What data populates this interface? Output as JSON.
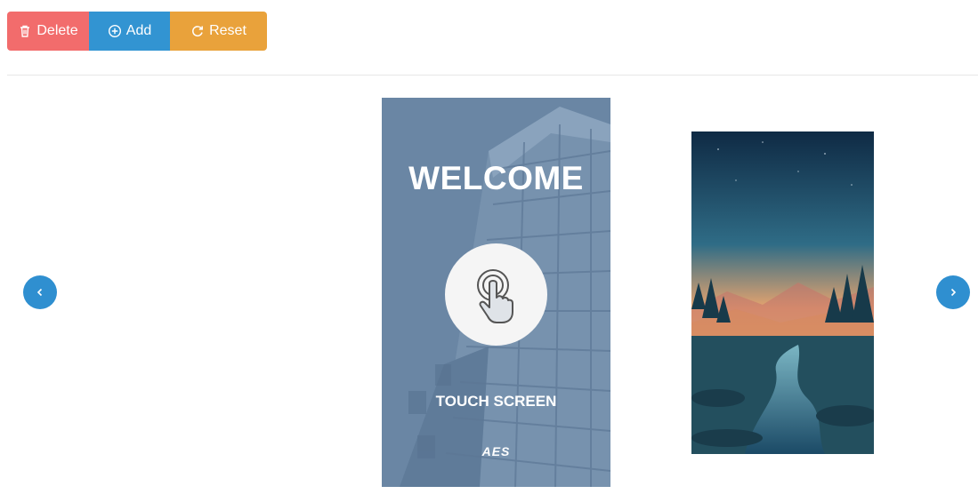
{
  "toolbar": {
    "delete_label": "Delete",
    "add_label": "Add",
    "reset_label": "Reset",
    "delete_icon": "trash-icon",
    "add_icon": "plus-circle-icon",
    "reset_icon": "refresh-icon",
    "colors": {
      "delete": "#f26c6c",
      "add": "#3294d2",
      "reset": "#e9a23b"
    }
  },
  "carousel": {
    "prev_icon": "chevron-left-icon",
    "next_icon": "chevron-right-icon",
    "nav_color": "#2f8fd0",
    "slides": [
      {
        "name": "welcome-slide",
        "title": "WELCOME",
        "icon": "touch-hand-icon",
        "caption": "TOUCH SCREEN",
        "brand": "AES"
      },
      {
        "name": "landscape-slide",
        "description_icon": "landscape-image"
      }
    ]
  }
}
